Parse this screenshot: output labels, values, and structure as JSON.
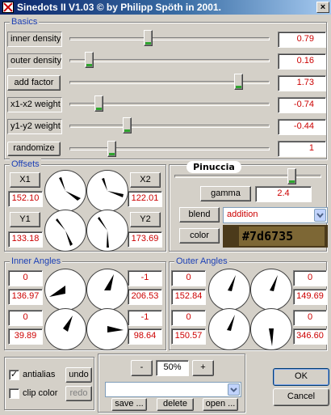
{
  "window": {
    "title": "Sinedots II V1.03 © by Philipp Spöth in 2001.",
    "close_label": "×"
  },
  "basics": {
    "title": "Basics",
    "rows": [
      {
        "label": "inner density",
        "value": "0.79",
        "position": 0.39
      },
      {
        "label": "outer density",
        "value": "0.16",
        "position": 0.08
      },
      {
        "label": "add factor",
        "value": "1.73",
        "position": 0.86
      },
      {
        "label": "x1-x2 weight",
        "value": "-0.74",
        "position": 0.13
      },
      {
        "label": "y1-y2 weight",
        "value": "-0.44",
        "position": 0.28
      },
      {
        "label": "randomize",
        "value": "1",
        "position": 0.2
      }
    ]
  },
  "offsets": {
    "title": "Offsets",
    "x1_label": "X1",
    "x1_value": "152.10",
    "x2_label": "X2",
    "x2_value": "122.01",
    "y1_label": "Y1",
    "y1_value": "133.18",
    "y2_label": "Y2",
    "y2_value": "173.69"
  },
  "render": {
    "logo": "Pinuccia",
    "gamma_label": "gamma",
    "gamma_value": "2.4",
    "gamma_position": 0.82,
    "blend_label": "blend",
    "blend_value": "addition",
    "color_label": "color",
    "color_value": "#7d6735"
  },
  "inner_angles": {
    "title": "Inner Angles",
    "tl_top": "0",
    "tl_bottom": "136.97",
    "tr_top": "-1",
    "tr_bottom": "206.53",
    "bl_top": "0",
    "bl_bottom": "39.89",
    "br_top": "-1",
    "br_bottom": "98.64"
  },
  "outer_angles": {
    "title": "Outer Angles",
    "tl_top": "0",
    "tl_bottom": "152.84",
    "tr_top": "0",
    "tr_bottom": "149.69",
    "bl_top": "0",
    "bl_bottom": "150.57",
    "br_top": "0",
    "br_bottom": "346.60"
  },
  "options": {
    "antialias_label": "antialias",
    "antialias_checked": true,
    "clip_color_label": "clip color",
    "clip_color_checked": false,
    "undo_label": "undo",
    "redo_label": "redo"
  },
  "presets": {
    "minus_label": "-",
    "zoom_value": "50%",
    "plus_label": "+",
    "preset_value": "",
    "save_label": "save ...",
    "delete_label": "delete",
    "open_label": "open ..."
  },
  "dialog": {
    "ok_label": "OK",
    "cancel_label": "Cancel"
  },
  "icons": {
    "close": "close-icon",
    "app": "app-icon",
    "dropdown": "chevron-down-icon",
    "check": "check-icon"
  }
}
